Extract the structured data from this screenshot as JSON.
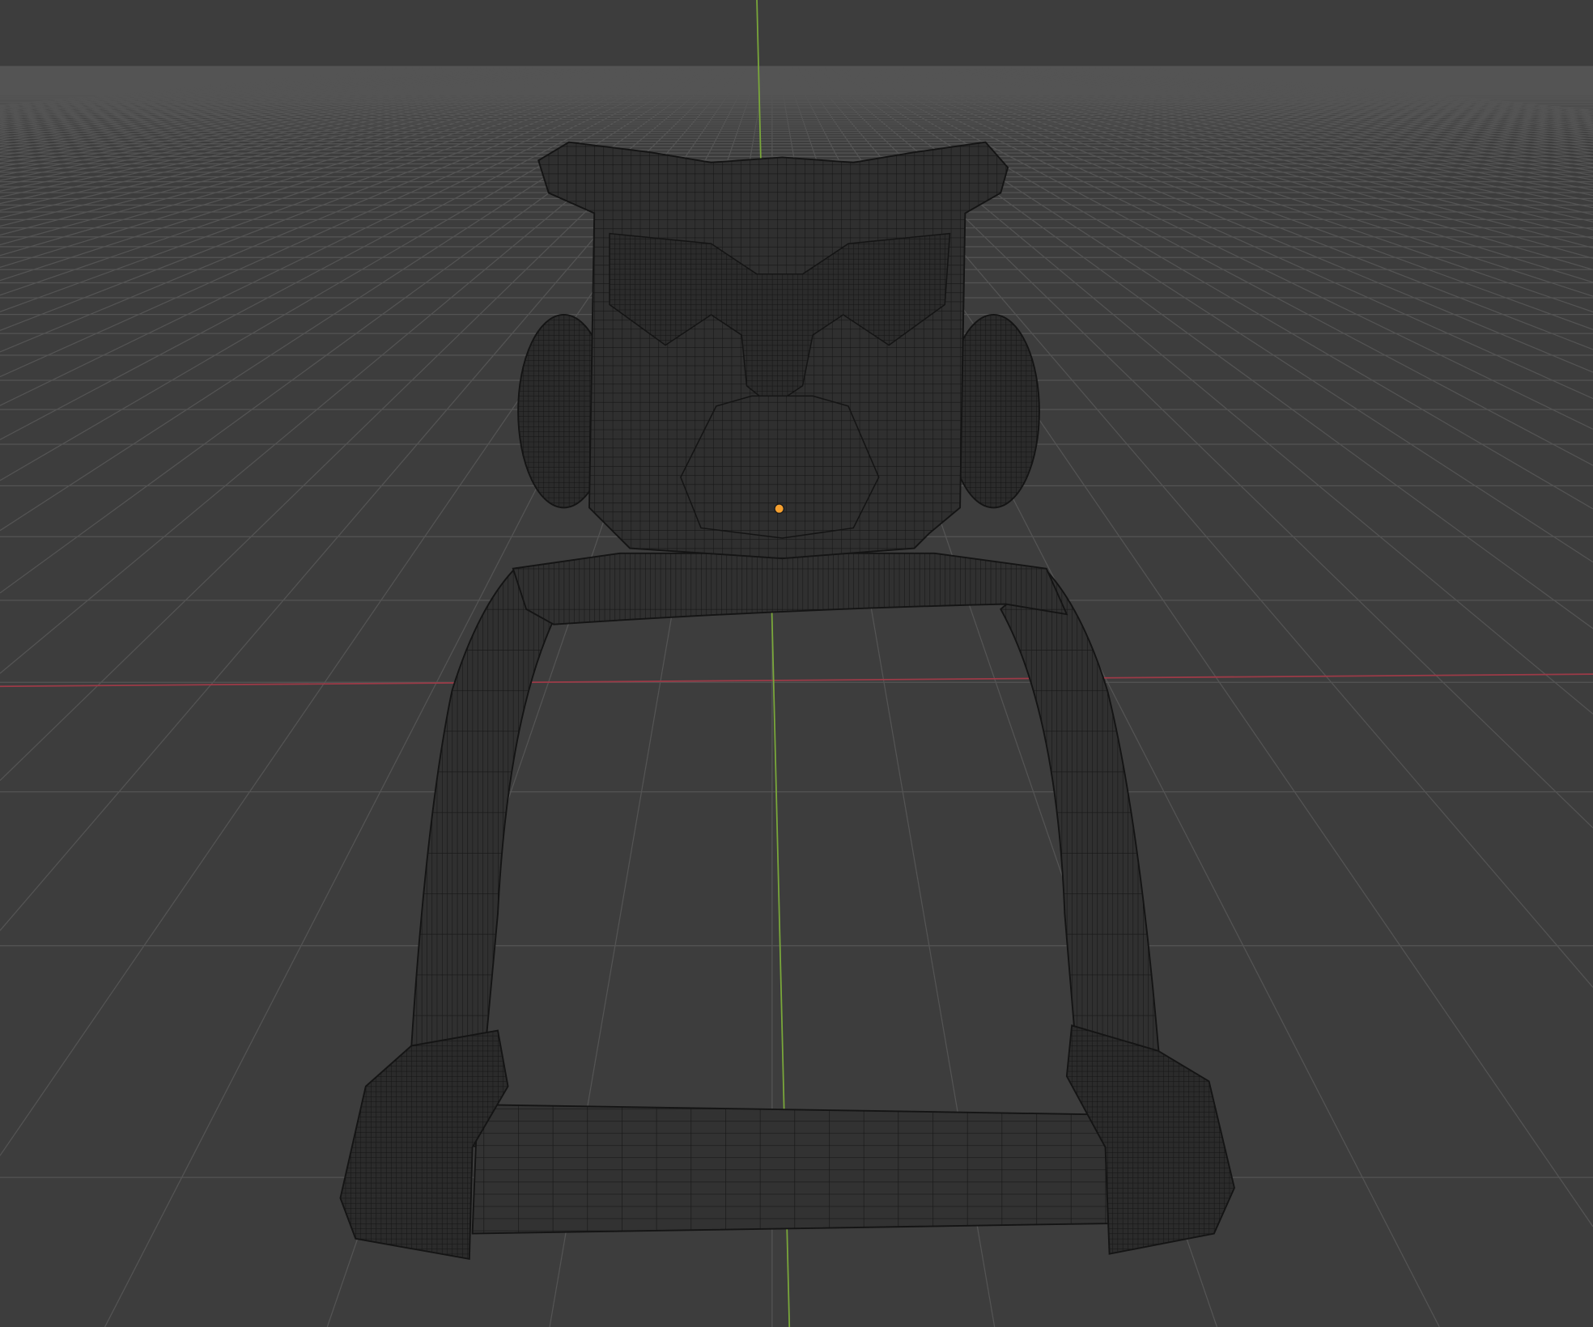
{
  "viewport": {
    "mode": "wireframe",
    "background": "#3d3d3d",
    "grid_color": "#545454",
    "x_axis_color": "#9c3a47",
    "y_axis_color": "#7aa83a",
    "mesh_fill": "#2e2e2e",
    "mesh_wire": "#151515",
    "origin_color": "#f5a030"
  }
}
